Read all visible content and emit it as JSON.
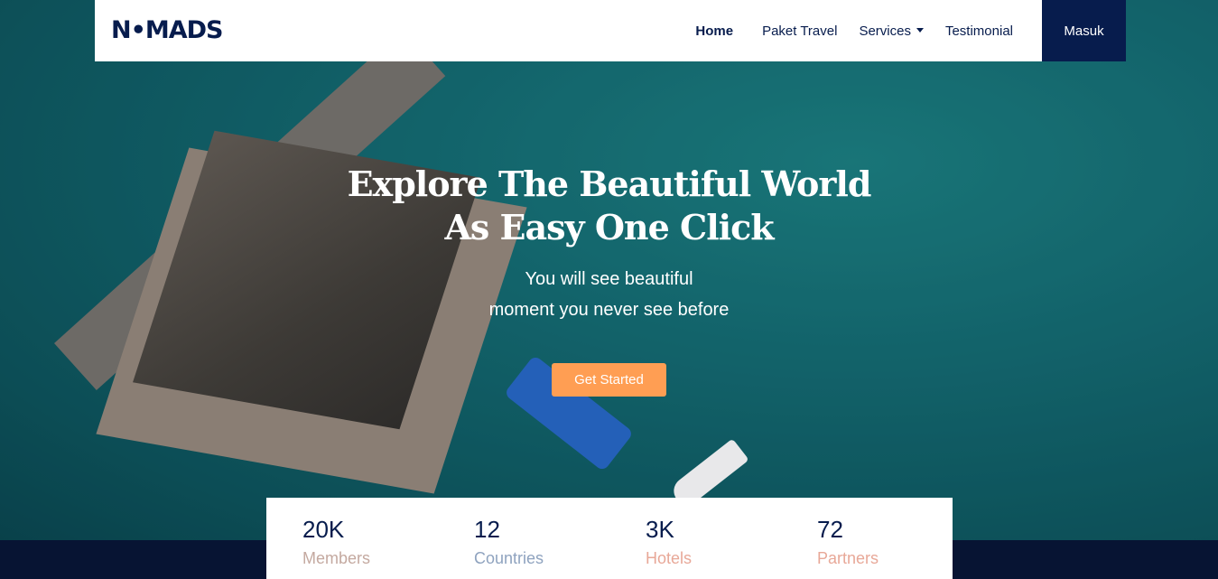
{
  "brand": {
    "logo": "N•MADS"
  },
  "nav": {
    "items": [
      {
        "label": "Home",
        "active": true
      },
      {
        "label": "Paket Travel"
      },
      {
        "label": "Services",
        "dropdown": true
      },
      {
        "label": "Testimonial"
      }
    ],
    "login_label": "Masuk"
  },
  "hero": {
    "title_line1": "Explore The Beautiful World",
    "title_line2": "As Easy One Click",
    "subtitle_line1": "You will see beautiful",
    "subtitle_line2": "moment you never see before",
    "cta_label": "Get Started"
  },
  "stats": [
    {
      "value": "20K",
      "label": "Members",
      "color": "#c4a9a0"
    },
    {
      "value": "12",
      "label": "Countries",
      "color": "#8fa3bf"
    },
    {
      "value": "3K",
      "label": "Hotels",
      "color": "#e8a898"
    },
    {
      "value": "72",
      "label": "Partners",
      "color": "#e8a898"
    }
  ],
  "colors": {
    "primary": "#071c4d",
    "accent": "#ff9e53"
  }
}
